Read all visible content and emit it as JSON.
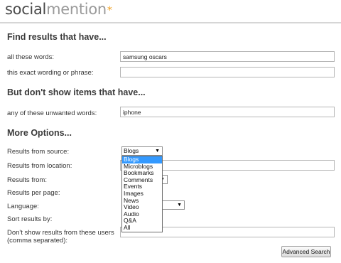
{
  "logo": {
    "part1": "social",
    "part2": "mention",
    "star": "*"
  },
  "sections": {
    "find": "Find results that have...",
    "exclude": "But don't show items that have...",
    "more": "More Options..."
  },
  "fields": {
    "all_words": {
      "label": "all these words:",
      "value": "samsung oscars"
    },
    "exact_phrase": {
      "label": "this exact wording or phrase:",
      "value": ""
    },
    "unwanted": {
      "label": "any of these unwanted words:",
      "value": "iphone"
    }
  },
  "options": {
    "source_label": "Results from source:",
    "source_value": "Blogs",
    "location_label": "Results from location:",
    "from_label": "Results from:",
    "per_page_label": "Results per page:",
    "language_label": "Language:",
    "sort_label": "Sort results by:",
    "exclude_users_label_1": "Don't show results from these users",
    "exclude_users_label_2": "(comma separated):"
  },
  "source_dropdown": {
    "items": [
      "Blogs",
      "Microblogs",
      "Bookmarks",
      "Comments",
      "Events",
      "Images",
      "News",
      "Video",
      "Audio",
      "Q&A",
      "All"
    ],
    "highlighted": "Blogs"
  },
  "button": {
    "advanced_search": "Advanced Search"
  },
  "colors": {
    "highlight": "#3399ff",
    "logo_star": "#f0a020"
  }
}
